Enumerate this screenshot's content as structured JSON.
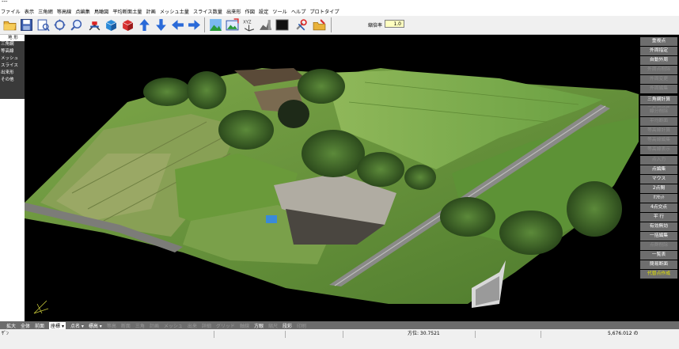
{
  "title_bar": {
    "text": "---"
  },
  "menu": [
    "ファイル",
    "表示",
    "三角網",
    "等高線",
    "点編集",
    "鳥瞰図",
    "平均断面土量",
    "計画",
    "メッシュ土量",
    "スライス数量",
    "出来形",
    "作図",
    "設定",
    "ツール",
    "ヘルプ",
    "プロトタイプ"
  ],
  "toolbar": {
    "zoom_label": "縮倍率",
    "zoom_value": "1.0"
  },
  "left_panel": {
    "header": "地 形",
    "items": [
      "三角網",
      "等高線",
      "メッシュ",
      "スライス",
      "出来形",
      "その他"
    ]
  },
  "right_panel": {
    "buttons": [
      {
        "label": "重複点",
        "state": "enabled"
      },
      {
        "label": "外周指定",
        "state": "enabled"
      },
      {
        "label": "自動外周",
        "state": "enabled"
      },
      {
        "label": "外周点削除",
        "state": "disabled"
      },
      {
        "label": "外周変更",
        "state": "disabled"
      },
      {
        "label": "外周編集",
        "state": "disabled"
      },
      {
        "label": "三角網計算",
        "state": "enabled"
      },
      {
        "label": "三角網編集",
        "state": "disabled"
      },
      {
        "label": "線分削除",
        "state": "disabled"
      },
      {
        "label": "平均断面",
        "state": "disabled"
      },
      {
        "label": "等高線計算",
        "state": "disabled"
      },
      {
        "label": "等高線編集",
        "state": "disabled"
      },
      {
        "label": "等高線表示",
        "state": "disabled"
      },
      {
        "label": "点入力",
        "state": "disabled"
      },
      {
        "label": "点編集",
        "state": "enabled"
      },
      {
        "label": "マウス",
        "state": "enabled"
      },
      {
        "label": "2点間",
        "state": "enabled"
      },
      {
        "label": "ｵﾌｾｯﾄ",
        "state": "enabled"
      },
      {
        "label": "4点交点",
        "state": "enabled"
      },
      {
        "label": "平 行",
        "state": "enabled"
      },
      {
        "label": "有効無効",
        "state": "enabled"
      },
      {
        "label": "一括編集",
        "state": "enabled"
      },
      {
        "label": "点群削除",
        "state": "disabled"
      },
      {
        "label": "一覧表",
        "state": "enabled"
      },
      {
        "label": "簡易断面",
        "state": "enabled"
      },
      {
        "label": "代替点作成",
        "state": "highlight"
      }
    ]
  },
  "bottom_bar": [
    {
      "label": "拡大",
      "state": "enabled"
    },
    {
      "label": "全体",
      "state": "enabled"
    },
    {
      "label": "前面",
      "state": "enabled"
    },
    {
      "label": "座標 ▾",
      "state": "selected"
    },
    {
      "label": "点名 ▾",
      "state": "enabled"
    },
    {
      "label": "標高 ▾",
      "state": "enabled"
    },
    {
      "label": "等高",
      "state": "disabled"
    },
    {
      "label": "断面",
      "state": "disabled"
    },
    {
      "label": "三角",
      "state": "disabled"
    },
    {
      "label": "計画",
      "state": "disabled"
    },
    {
      "label": "メッシュ",
      "state": "disabled"
    },
    {
      "label": "出来",
      "state": "disabled"
    },
    {
      "label": "詳細",
      "state": "disabled"
    },
    {
      "label": "グリッド",
      "state": "disabled"
    },
    {
      "label": "軸線",
      "state": "disabled"
    },
    {
      "label": "方眼",
      "state": "enabled"
    },
    {
      "label": "縮尺",
      "state": "disabled"
    },
    {
      "label": "段彩",
      "state": "enabled"
    },
    {
      "label": "印刷",
      "state": "disabled"
    }
  ],
  "status": {
    "left": "ｻﾞﾝ",
    "angle": "方位: 30.7521",
    "value": "5,676.012 の"
  },
  "colors": {
    "viewport_bg": "#000000",
    "panel_btn": "#6e6e6e",
    "bottom_bar": "#6c6c6c",
    "highlight": "#e6e600",
    "zoom_box": "#ffffc0"
  }
}
